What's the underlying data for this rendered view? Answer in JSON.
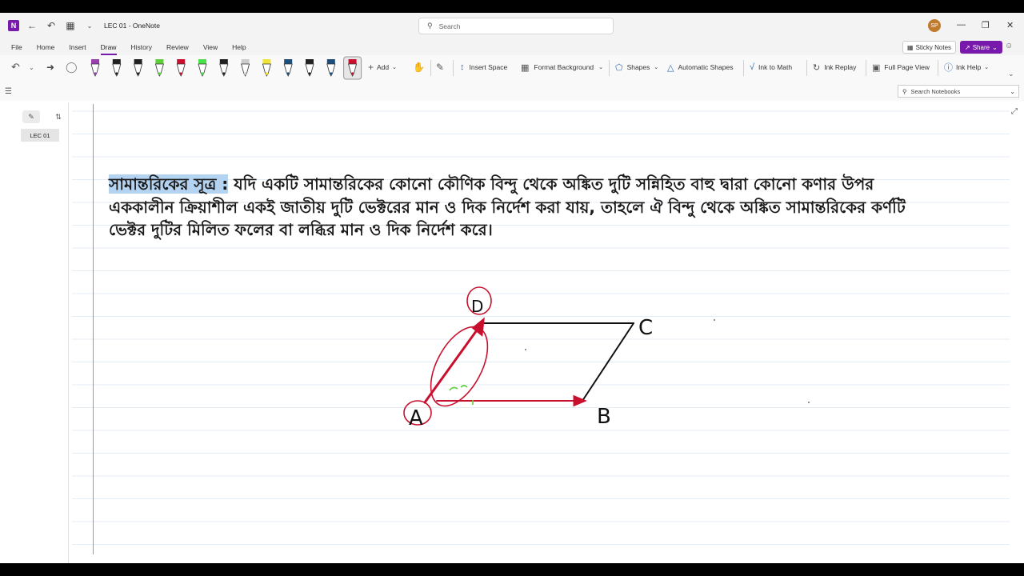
{
  "window": {
    "doc_title": "LEC 01 - OneNote",
    "search_placeholder": "Search",
    "avatar_initials": "SP"
  },
  "menu": {
    "items": [
      "File",
      "Home",
      "Insert",
      "Draw",
      "History",
      "Review",
      "View",
      "Help"
    ],
    "active": "Draw",
    "sticky_notes": "Sticky Notes",
    "share": "Share"
  },
  "ribbon": {
    "add": "Add",
    "insert_space": "Insert Space",
    "format_background": "Format Background",
    "shapes": "Shapes",
    "automatic_shapes": "Automatic Shapes",
    "ink_to_math": "Ink to Math",
    "ink_replay": "Ink Replay",
    "full_page_view": "Full Page View",
    "ink_help": "Ink Help",
    "pen_colors": [
      "#9b3fb0",
      "#222222",
      "#222222",
      "#5fcf3a",
      "#c8102e",
      "#4ae04a",
      "#222222",
      "#cccccc",
      "#f0e43a",
      "#1d4e7a",
      "#222222",
      "#1d4e7a",
      "#c8102e"
    ]
  },
  "notebook": {
    "search_placeholder": "Search Notebooks",
    "pages": [
      "LEC 01"
    ]
  },
  "note": {
    "highlighted": "সামান্তরিকের সূত্র :",
    "body": " যদি একটি সামান্তরিকের কোনো কৌণিক বিন্দু থেকে অঙ্কিত দুটি সন্নিহিত বাহু দ্বারা কোনো কণার উপর এককালীন ক্রিয়াশীল একই জাতীয় দুটি ভেক্টরের মান ও দিক নির্দেশ করা যায়, তাহলে ঐ বিন্দু থেকে অঙ্কিত সামান্তরিকের কর্ণটি ভেক্টর দুটির মিলিত ফলের বা লব্ধির মান ও দিক নির্দেশ করে।"
  },
  "ink": {
    "labels": [
      "A",
      "B",
      "C",
      "D"
    ],
    "colors": {
      "ink": "#111111",
      "vector": "#c8102e",
      "highlighter_green": "#5fcf3a"
    }
  }
}
